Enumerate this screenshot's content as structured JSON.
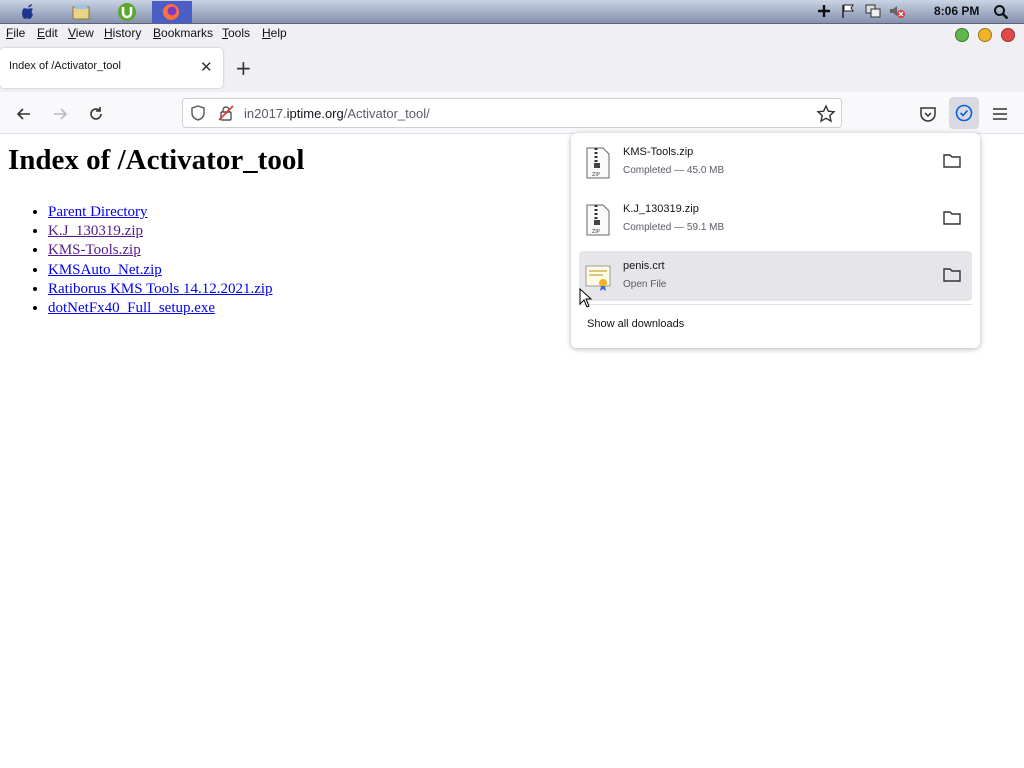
{
  "os": {
    "apps": [
      "apple-icon",
      "file-manager-icon",
      "utorrent-icon",
      "firefox-icon"
    ],
    "tray_icons": [
      "plus-icon",
      "flag-icon",
      "network-icon",
      "volume-muted-icon"
    ],
    "clock": "8:06 PM"
  },
  "menu": {
    "items": [
      "File",
      "Edit",
      "View",
      "History",
      "Bookmarks",
      "Tools",
      "Help"
    ]
  },
  "window_buttons": {
    "maximize_color": "#5fb84a",
    "minimize_color": "#f0b429",
    "close_color": "#e24a4a"
  },
  "tabs": [
    {
      "title": "Index of /Activator_tool",
      "close_icon": "close-icon"
    }
  ],
  "nav": {
    "url_prefix": "in2017.",
    "url_host": "iptime.org",
    "url_path": "/Activator_tool/"
  },
  "page": {
    "title": "Index of /Activator_tool",
    "links": [
      {
        "label": "Parent Directory",
        "visited": false
      },
      {
        "label": "K.J_130319.zip",
        "visited": true
      },
      {
        "label": "KMS-Tools.zip",
        "visited": true
      },
      {
        "label": "KMSAuto_Net.zip",
        "visited": false
      },
      {
        "label": "Ratiborus KMS Tools 14.12.2021.zip",
        "visited": false
      },
      {
        "label": "dotNetFx40_Full_setup.exe",
        "visited": false
      }
    ]
  },
  "downloads": {
    "items": [
      {
        "name": "KMS-Tools.zip",
        "status": "Completed — 45.0 MB",
        "icon": "zip-file-icon"
      },
      {
        "name": "K.J_130319.zip",
        "status": "Completed — 59.1 MB",
        "icon": "zip-file-icon"
      },
      {
        "name": "penis.crt",
        "status": "Open File",
        "icon": "certificate-file-icon"
      }
    ],
    "show_all": "Show all downloads"
  }
}
